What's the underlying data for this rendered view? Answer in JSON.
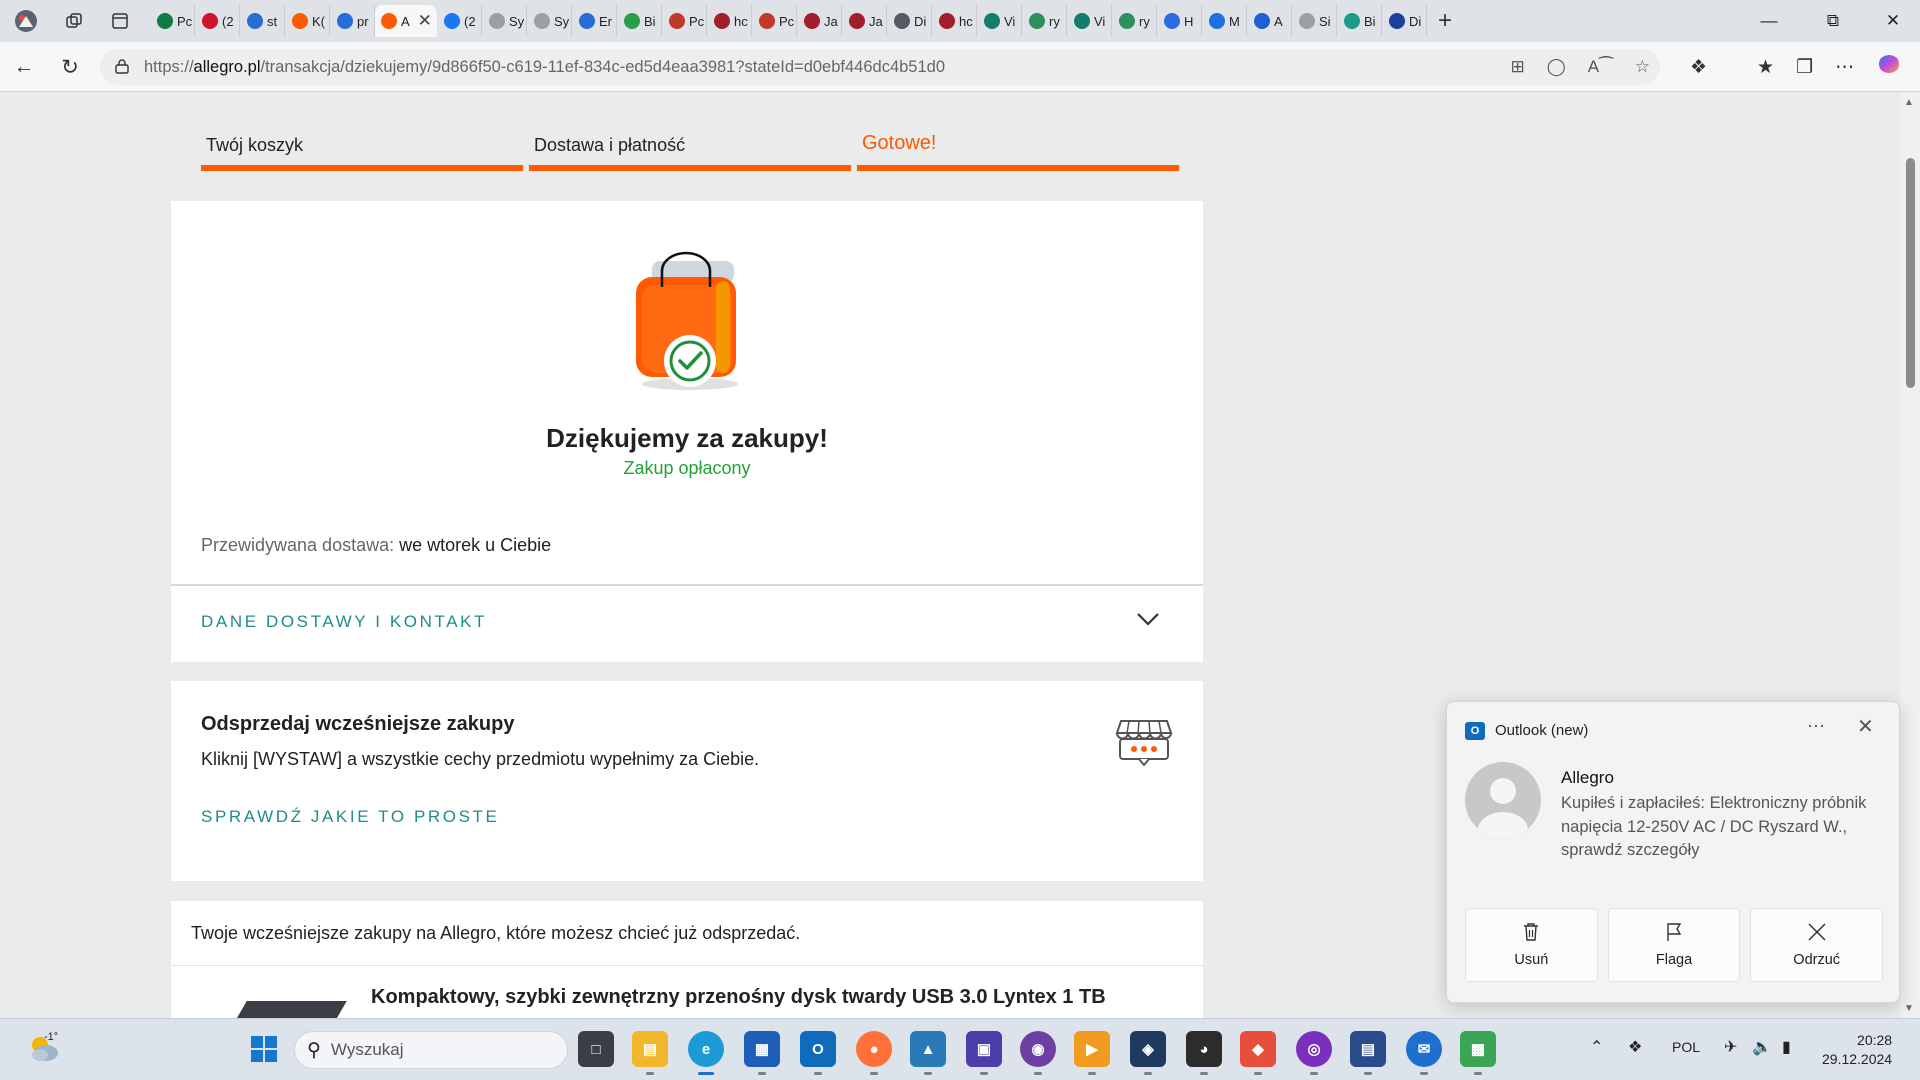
{
  "browser": {
    "url_prefix": "https://",
    "url_host": "allegro.pl",
    "url_path": "/transakcja/dziekujemy/9d866f50-c619-11ef-834c-ed5d4eaa3981?stateId=d0ebf446dc4b51d0",
    "active_tab_text": "A",
    "tabs": [
      {
        "text": "Pc",
        "icon": "excel-icon",
        "color": "#107c41"
      },
      {
        "text": "(2",
        "icon": "youtube-icon",
        "color": "#d0142a"
      },
      {
        "text": "st",
        "icon": "search-icon",
        "color": "#2a6cd6"
      },
      {
        "text": "K(",
        "icon": "allegro-icon",
        "color": "#ff5a00"
      },
      {
        "text": "pr",
        "icon": "search-icon",
        "color": "#2a6cd6"
      },
      {
        "text": "(2",
        "icon": "facebook-icon",
        "color": "#1877f2"
      },
      {
        "text": "Sy",
        "icon": "page-icon",
        "color": "#9aa0a6"
      },
      {
        "text": "Sy",
        "icon": "page-icon",
        "color": "#9aa0a6"
      },
      {
        "text": "Er",
        "icon": "search-icon",
        "color": "#2a6cd6"
      },
      {
        "text": "Bi",
        "icon": "check-icon",
        "color": "#2a9d4b"
      },
      {
        "text": "Pc",
        "icon": "e-icon",
        "color": "#c0392b"
      },
      {
        "text": "hc",
        "icon": "circle-icon",
        "color": "#a31d2b"
      },
      {
        "text": "Pc",
        "icon": "e-icon",
        "color": "#c0392b"
      },
      {
        "text": "Ja",
        "icon": "circle-icon",
        "color": "#a31d2b"
      },
      {
        "text": "Ja",
        "icon": "circle-icon",
        "color": "#a31d2b"
      },
      {
        "text": "Di",
        "icon": "globe-icon",
        "color": "#555b62"
      },
      {
        "text": "hc",
        "icon": "circle-icon",
        "color": "#a31d2b"
      },
      {
        "text": "Vi",
        "icon": "diamond-icon",
        "color": "#137d6b"
      },
      {
        "text": "ry",
        "icon": "leaf-icon",
        "color": "#2f8f5b"
      },
      {
        "text": "Vi",
        "icon": "diamond-icon",
        "color": "#137d6b"
      },
      {
        "text": "ry",
        "icon": "leaf-icon",
        "color": "#2f8f5b"
      },
      {
        "text": "H",
        "icon": "at-icon",
        "color": "#2b6be0"
      },
      {
        "text": "M",
        "icon": "mail-icon",
        "color": "#1f6fe0"
      },
      {
        "text": "A",
        "icon": "doc-icon",
        "color": "#1f5fd0"
      },
      {
        "text": "Si",
        "icon": "page-icon",
        "color": "#9aa0a6"
      },
      {
        "text": "Bi",
        "icon": "sparkle-icon",
        "color": "#1a9c8c"
      },
      {
        "text": "Di",
        "icon": "shield-icon",
        "color": "#1c3f9c"
      }
    ]
  },
  "steps": [
    {
      "label": "Twój koszyk",
      "active": false
    },
    {
      "label": "Dostawa i płatność",
      "active": false
    },
    {
      "label": "Gotowe!",
      "active": true
    }
  ],
  "confirmation": {
    "title": "Dziękujemy za zakupy!",
    "status": "Zakup opłacony",
    "delivery_label": "Przewidywana dostawa:",
    "delivery_value": "we wtorek u Ciebie",
    "contact_toggle": "DANE DOSTAWY I KONTAKT"
  },
  "resell": {
    "title": "Odsprzedaj wcześniejsze zakupy",
    "text": "Kliknij [WYSTAW] a wszystkie cechy przedmiotu wypełnimy za Ciebie.",
    "link": "SPRAWDŹ JAKIE TO PROSTE"
  },
  "previous": {
    "text": "Twoje wcześniejsze zakupy na Allegro, które możesz chcieć już odsprzedać.",
    "product": "Kompaktowy, szybki zewnętrzny przenośny dysk twardy USB 3.0 Lyntex 1 TB"
  },
  "notification": {
    "app": "Outlook (new)",
    "sender": "Allegro",
    "body": "Kupiłeś i zapłaciłeś: Elektroniczny próbnik napięcia 12-250V AC / DC Ryszard W., sprawdź szczegóły",
    "actions": {
      "delete": "Usuń",
      "flag": "Flaga",
      "dismiss": "Odrzuć"
    }
  },
  "taskbar": {
    "weather_temp": "-1°",
    "search_placeholder": "Wyszukaj",
    "language": "POL",
    "time": "20:28",
    "date": "29.12.2024"
  }
}
